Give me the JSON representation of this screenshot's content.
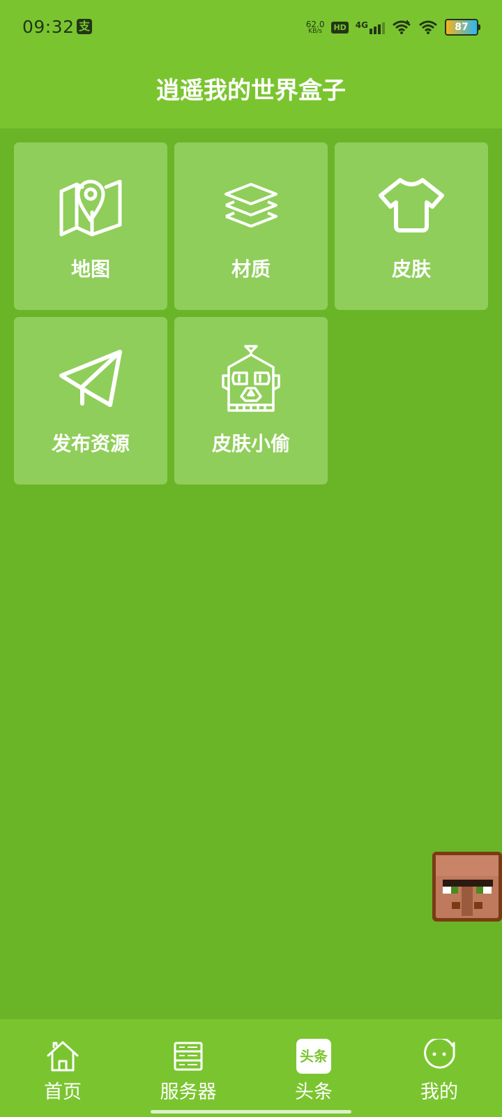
{
  "status_bar": {
    "time": "09:32",
    "app_icon_char": "支",
    "net_speed_value": "62.0",
    "net_speed_unit": "KB/s",
    "hd_label": "HD",
    "network_type": "4G",
    "battery_level": "87"
  },
  "header": {
    "title": "逍遥我的世界盒子"
  },
  "tiles": [
    {
      "label": "地图",
      "icon": "map-pin-icon"
    },
    {
      "label": "材质",
      "icon": "layers-icon"
    },
    {
      "label": "皮肤",
      "icon": "tshirt-icon"
    },
    {
      "label": "发布资源",
      "icon": "paper-plane-icon"
    },
    {
      "label": "皮肤小偷",
      "icon": "robot-icon"
    }
  ],
  "floating_button": {
    "icon": "villager-head-icon"
  },
  "bottom_nav": {
    "items": [
      {
        "label": "首页",
        "icon": "home-icon"
      },
      {
        "label": "服务器",
        "icon": "server-icon"
      },
      {
        "label": "头条",
        "icon": "toutiao-icon",
        "badge_text": "头条"
      },
      {
        "label": "我的",
        "icon": "profile-face-icon"
      }
    ]
  },
  "colors": {
    "header_green": "#7ac52f",
    "body_green": "#6ab428",
    "tile_green": "#8fce5a",
    "status_text": "#233517"
  }
}
